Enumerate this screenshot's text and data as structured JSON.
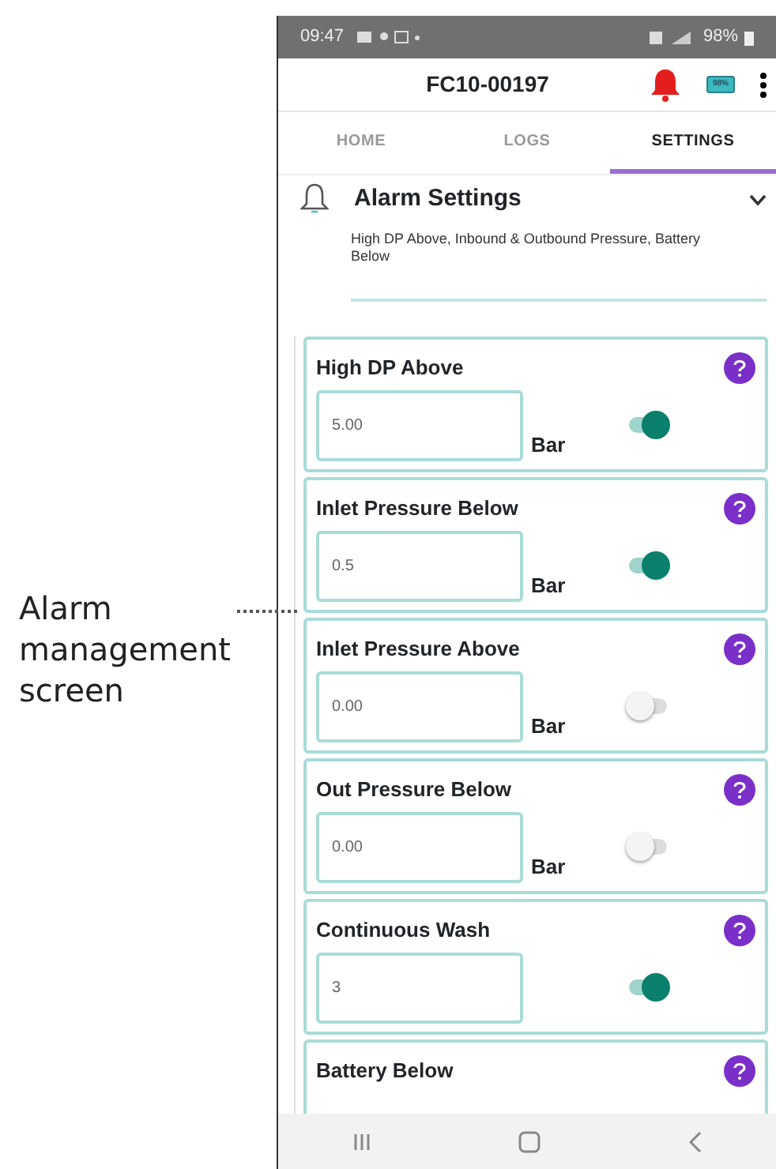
{
  "annotation": {
    "text": "Alarm management screen"
  },
  "status_bar": {
    "time": "09:47",
    "battery": "98%"
  },
  "header": {
    "title": "FC10-00197",
    "alarm_active": true,
    "battery_badge": "98%"
  },
  "tabs": [
    {
      "label": "HOME",
      "selected": false
    },
    {
      "label": "LOGS",
      "selected": false
    },
    {
      "label": "SETTINGS",
      "selected": true
    }
  ],
  "section": {
    "title": "Alarm Settings",
    "expanded": true,
    "description": "High DP Above, Inbound & Outbound Pressure, Battery Below"
  },
  "alarms": [
    {
      "title": "High DP Above",
      "value": "5.00",
      "unit": "Bar",
      "on": true
    },
    {
      "title": "Inlet Pressure Below",
      "value": "0.5",
      "unit": "Bar",
      "on": true
    },
    {
      "title": "Inlet Pressure Above",
      "value": "0.00",
      "unit": "Bar",
      "on": false
    },
    {
      "title": "Out Pressure Below",
      "value": "0.00",
      "unit": "Bar",
      "on": false
    },
    {
      "title": "Continuous Wash",
      "value": "3",
      "on": true
    },
    {
      "title": "Battery Below"
    }
  ]
}
